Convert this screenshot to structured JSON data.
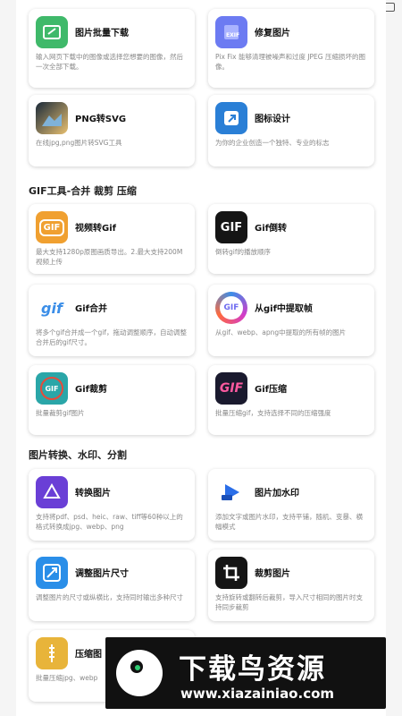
{
  "sections": [
    {
      "title": "GIF工具-合并 裁剪 压缩"
    },
    {
      "title": "图片转换、水印、分割"
    }
  ],
  "cards": [
    {
      "title": "图片批量下载",
      "desc": "输入网页下载中的图像或选择您想要的图像，然后一次全部下载。",
      "icon": "download-icon",
      "color": "#3fb96a"
    },
    {
      "title": "修复图片",
      "desc": "Pix Fix 能够清理被噪声和过度 JPEG 压缩损坏的图像。",
      "icon": "exif-icon",
      "color": "#6c7bf2"
    },
    {
      "title": "PNG转SVG",
      "desc": "在线jpg,png图片转SVG工具",
      "icon": "landscape-icon",
      "color": "#2b4a68"
    },
    {
      "title": "图标设计",
      "desc": "为你的企业创造一个独特、专业的标志",
      "icon": "logo-design-icon",
      "color": "#2a7fd6"
    },
    {
      "title": "视频转Gif",
      "desc": "最大支持1280p原图画质导出。2.最大支持200M视频上传",
      "icon": "gif-icon",
      "color": "#f0a030"
    },
    {
      "title": "Gif倒转",
      "desc": "倒转gif的播放顺序",
      "icon": "gif-reverse-icon",
      "color": "#151515"
    },
    {
      "title": "Gif合并",
      "desc": "将多个gif合并成一个gif，拖动调整顺序，自动调整合并后的gif尺寸。",
      "icon": "gif-merge-icon",
      "color": "#ffffff"
    },
    {
      "title": "从gif中提取帧",
      "desc": "从gif、webp、apng中提取的所有帧的图片",
      "icon": "gif-extract-icon",
      "color": "#6e6bf0"
    },
    {
      "title": "Gif裁剪",
      "desc": "批量裁剪gif图片",
      "icon": "gif-crop-icon",
      "color": "#2aa6a8"
    },
    {
      "title": "Gif压缩",
      "desc": "批量压缩gif，支持选择不同的压缩强度",
      "icon": "gif-compress-icon",
      "color": "#1a1a2e"
    },
    {
      "title": "转换图片",
      "desc": "支持将pdf、psd、heic、raw、tiff等60种以上的格式转换成jpg、webp、png",
      "icon": "convert-icon",
      "color": "#6a3fd6"
    },
    {
      "title": "图片加水印",
      "desc": "添加文字或图片水印，支持平铺，随机、变暴、横幅模式",
      "icon": "watermark-icon",
      "color": "#2a6ee8"
    },
    {
      "title": "调整图片尺寸",
      "desc": "调整图片的尺寸或纵横比，支持同时输出多种尺寸",
      "icon": "resize-icon",
      "color": "#2a8ee8"
    },
    {
      "title": "裁剪图片",
      "desc": "支持旋转或翻转后裁剪，导入尺寸相同的图片时支持同步裁剪",
      "icon": "crop-icon",
      "color": "#151515"
    },
    {
      "title": "压缩图",
      "desc": "批量压缩jpg、webp",
      "icon": "compress-icon",
      "color": "#e8b43a"
    }
  ],
  "ad": {
    "brand": "下载鸟资源",
    "url": "www.xiazainiao.com"
  }
}
